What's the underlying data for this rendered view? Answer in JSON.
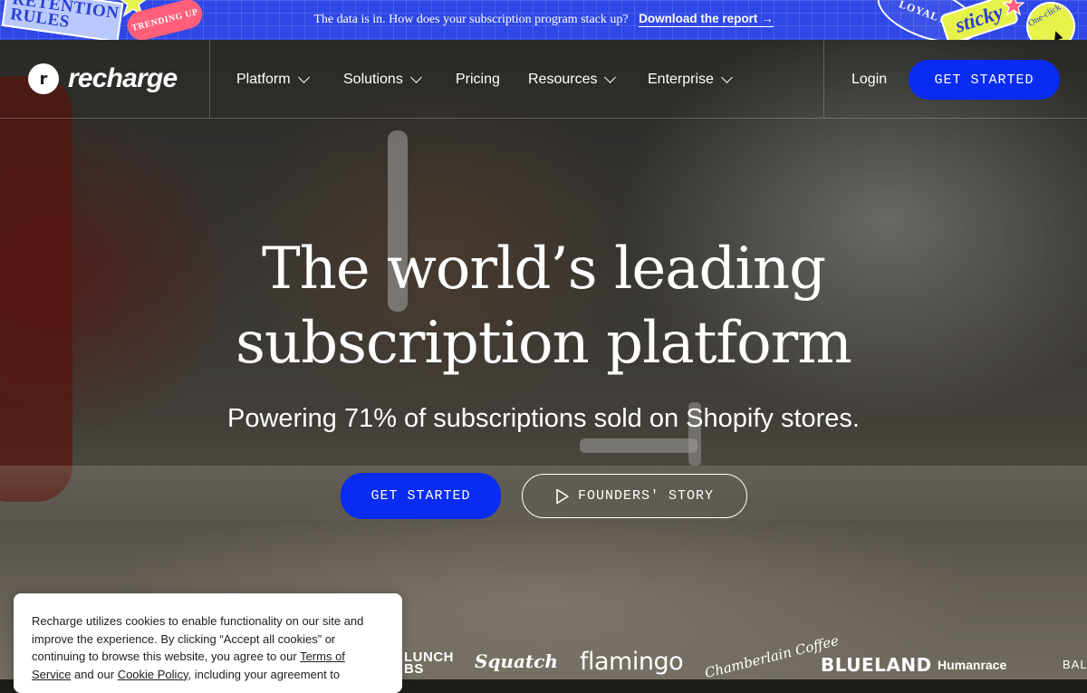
{
  "banner": {
    "message": "The data is in. How does your subscription program stack up?",
    "link_label": "Download the report",
    "link_arrow": "→",
    "stickers": {
      "retention": "RETENTION RULES",
      "trending": "TRENDING UP",
      "loyal": "LOYAL AF",
      "sticky": "sticky",
      "one_click": "One-click"
    },
    "colors": {
      "background": "#2f47e6",
      "sticker_yellow": "#e6f24a",
      "sticker_pink": "#ff5f7a"
    }
  },
  "nav": {
    "logo_mark": "r",
    "logo_text": "recharge",
    "items": [
      {
        "label": "Platform",
        "has_dropdown": true
      },
      {
        "label": "Solutions",
        "has_dropdown": true
      },
      {
        "label": "Pricing",
        "has_dropdown": false
      },
      {
        "label": "Resources",
        "has_dropdown": true
      },
      {
        "label": "Enterprise",
        "has_dropdown": true
      }
    ],
    "login_label": "Login",
    "cta_label": "GET STARTED"
  },
  "hero": {
    "title_line1": "The world’s leading",
    "title_line2": "subscription platform",
    "subtitle": "Powering 71% of subscriptions sold on Shopify stores.",
    "primary_cta": "GET STARTED",
    "secondary_cta": "FOUNDERS' STORY",
    "secondary_icon": "play-icon"
  },
  "brands": {
    "lunch": "LUNCH\nBS",
    "squatch": "Squatch",
    "flamingo": "flamingo",
    "chamberlain": "Chamberlain Coffee",
    "blueland": "BLUELAND",
    "humanrace": "Humanrace",
    "bala": "BALA"
  },
  "cookie": {
    "text_before_terms": "Recharge utilizes cookies to enable functionality on our site and improve the experience. By clicking “Accept all cookies” or continuing to browse this website, you agree to our ",
    "terms_link": "Terms of Service",
    "text_between": " and our ",
    "cookie_link": "Cookie Policy",
    "text_after": ", including your agreement to"
  },
  "colors": {
    "accent": "#0a2bf2",
    "text_on_dark": "#ffffff"
  }
}
